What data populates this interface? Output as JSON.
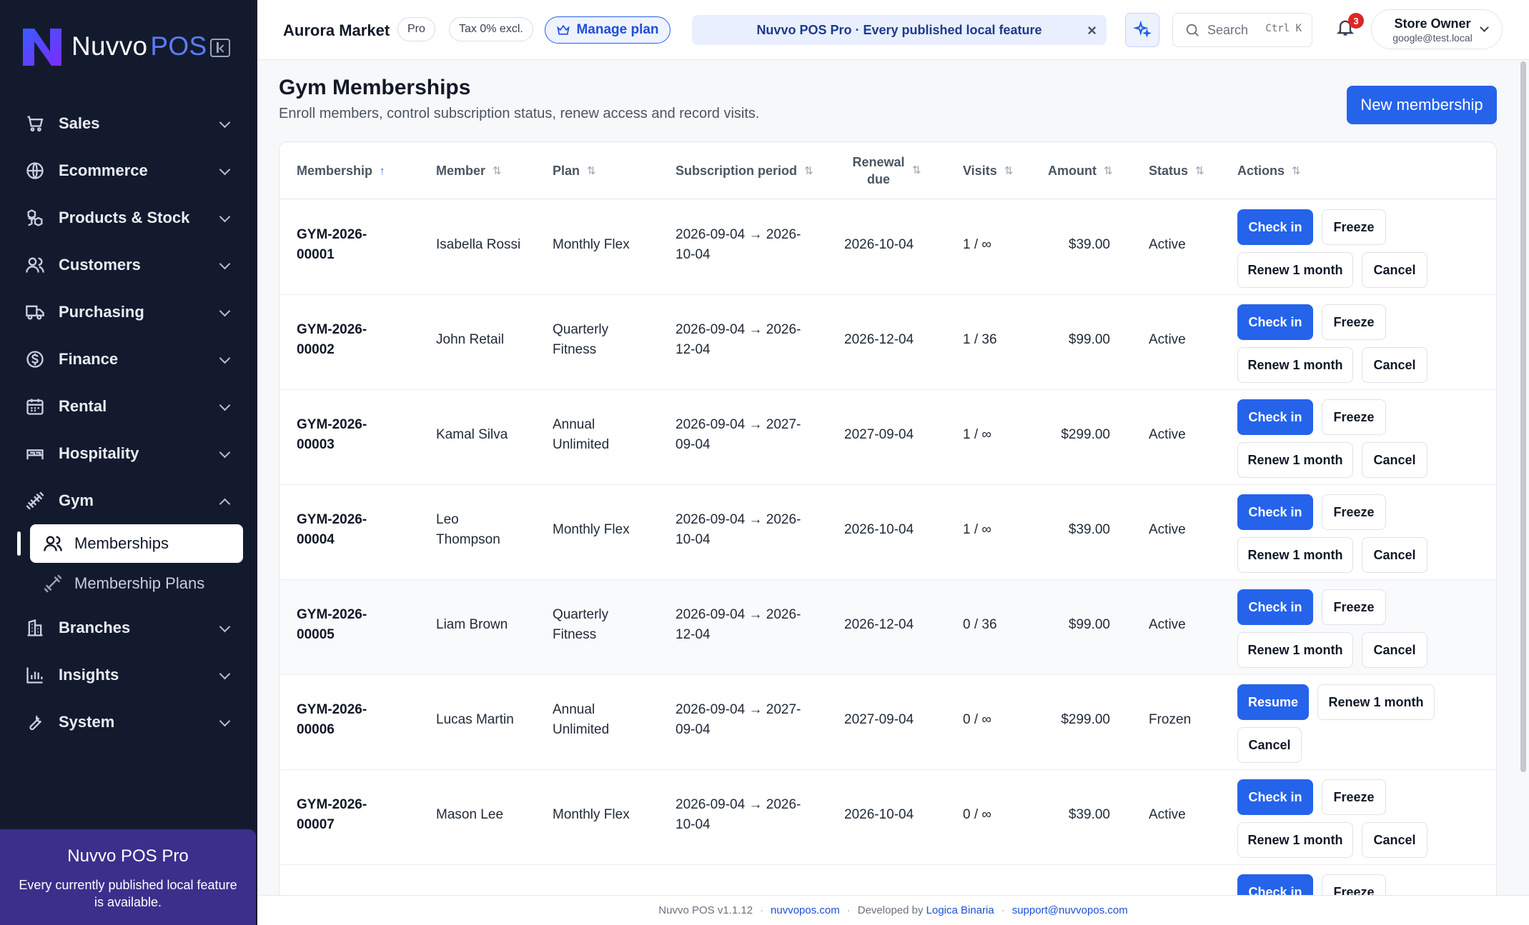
{
  "brand": {
    "name": "Nuvvo",
    "suffix": "POS"
  },
  "sidebar": {
    "items": [
      {
        "label": "Sales",
        "icon": "cart-icon"
      },
      {
        "label": "Ecommerce",
        "icon": "globe-icon"
      },
      {
        "label": "Products & Stock",
        "icon": "boxes-icon"
      },
      {
        "label": "Customers",
        "icon": "users-icon"
      },
      {
        "label": "Purchasing",
        "icon": "truck-icon"
      },
      {
        "label": "Finance",
        "icon": "dollar-icon"
      },
      {
        "label": "Rental",
        "icon": "calendar-icon"
      },
      {
        "label": "Hospitality",
        "icon": "bed-icon"
      },
      {
        "label": "Gym",
        "icon": "dumbbell-icon"
      },
      {
        "label": "Branches",
        "icon": "building-icon"
      },
      {
        "label": "Insights",
        "icon": "chart-icon"
      },
      {
        "label": "System",
        "icon": "wrench-icon"
      }
    ],
    "gym_sub": [
      {
        "label": "Memberships",
        "icon": "users-icon"
      },
      {
        "label": "Membership Plans",
        "icon": "dumbbell-icon"
      }
    ],
    "promo": {
      "title": "Nuvvo POS Pro",
      "text": "Every currently published local feature is available."
    }
  },
  "header": {
    "store": "Aurora Market",
    "plan_pill": "Pro",
    "tax_pill": "Tax 0% excl.",
    "manage_plan": "Manage plan",
    "banner": "Nuvvo POS Pro · Every published local feature",
    "banner_close": "×",
    "search_placeholder": "Search",
    "search_shortcut": "Ctrl K",
    "notifications": "3",
    "user_name": "Store Owner",
    "user_email": "google@test.local"
  },
  "page": {
    "title": "Gym Memberships",
    "subtitle": "Enroll members, control subscription status, renew access and record visits.",
    "new_button": "New membership"
  },
  "table": {
    "columns": {
      "membership": "Membership",
      "member": "Member",
      "plan": "Plan",
      "period": "Subscription period",
      "renewal_1": "Renewal",
      "renewal_2": "due",
      "visits": "Visits",
      "amount": "Amount",
      "status": "Status",
      "actions": "Actions"
    },
    "sort_asc": "↑",
    "sort_none": "⇅",
    "rows": [
      {
        "id1": "GYM-2026-",
        "id2": "00001",
        "member1": "Isabella Rossi",
        "member2": "",
        "plan1": "Monthly Flex",
        "plan2": "",
        "period1": "2026-09-04 → 2026-",
        "period2": "10-04",
        "renewal": "2026-10-04",
        "visits": "1 / ∞",
        "amount": "$39.00",
        "status": "Active",
        "actions": [
          "Check in",
          "Freeze",
          "Renew 1 month",
          "Cancel"
        ]
      },
      {
        "id1": "GYM-2026-",
        "id2": "00002",
        "member1": "John Retail",
        "member2": "",
        "plan1": "Quarterly",
        "plan2": "Fitness",
        "period1": "2026-09-04 → 2026-",
        "period2": "12-04",
        "renewal": "2026-12-04",
        "visits": "1 / 36",
        "amount": "$99.00",
        "status": "Active",
        "actions": [
          "Check in",
          "Freeze",
          "Renew 1 month",
          "Cancel"
        ]
      },
      {
        "id1": "GYM-2026-",
        "id2": "00003",
        "member1": "Kamal Silva",
        "member2": "",
        "plan1": "Annual",
        "plan2": "Unlimited",
        "period1": "2026-09-04 → 2027-",
        "period2": "09-04",
        "renewal": "2027-09-04",
        "visits": "1 / ∞",
        "amount": "$299.00",
        "status": "Active",
        "actions": [
          "Check in",
          "Freeze",
          "Renew 1 month",
          "Cancel"
        ]
      },
      {
        "id1": "GYM-2026-",
        "id2": "00004",
        "member1": "Leo",
        "member2": "Thompson",
        "plan1": "Monthly Flex",
        "plan2": "",
        "period1": "2026-09-04 → 2026-",
        "period2": "10-04",
        "renewal": "2026-10-04",
        "visits": "1 / ∞",
        "amount": "$39.00",
        "status": "Active",
        "actions": [
          "Check in",
          "Freeze",
          "Renew 1 month",
          "Cancel"
        ]
      },
      {
        "id1": "GYM-2026-",
        "id2": "00005",
        "member1": "Liam Brown",
        "member2": "",
        "plan1": "Quarterly",
        "plan2": "Fitness",
        "period1": "2026-09-04 → 2026-",
        "period2": "12-04",
        "renewal": "2026-12-04",
        "visits": "0 / 36",
        "amount": "$99.00",
        "status": "Active",
        "actions": [
          "Check in",
          "Freeze",
          "Renew 1 month",
          "Cancel"
        ]
      },
      {
        "id1": "GYM-2026-",
        "id2": "00006",
        "member1": "Lucas Martin",
        "member2": "",
        "plan1": "Annual",
        "plan2": "Unlimited",
        "period1": "2026-09-04 → 2027-",
        "period2": "09-04",
        "renewal": "2027-09-04",
        "visits": "0 / ∞",
        "amount": "$299.00",
        "status": "Frozen",
        "actions": [
          "Resume",
          "Renew 1 month",
          "Cancel"
        ]
      },
      {
        "id1": "GYM-2026-",
        "id2": "00007",
        "member1": "Mason Lee",
        "member2": "",
        "plan1": "Monthly Flex",
        "plan2": "",
        "period1": "2026-09-04 → 2026-",
        "period2": "10-04",
        "renewal": "2026-10-04",
        "visits": "0 / ∞",
        "amount": "$39.00",
        "status": "Active",
        "actions": [
          "Check in",
          "Freeze",
          "Renew 1 month",
          "Cancel"
        ]
      },
      {
        "id1": "",
        "id2": "",
        "member1": "",
        "member2": "",
        "plan1": "",
        "plan2": "",
        "period1": "",
        "period2": "",
        "renewal": "",
        "visits": "",
        "amount": "",
        "status": "",
        "actions": [
          "Check in",
          "Freeze"
        ]
      }
    ]
  },
  "footer": {
    "version": "Nuvvo POS v1.1.12",
    "site": "nuvvopos.com",
    "dev_prefix": "Developed by",
    "dev_name": "Logica Binaria",
    "support": "support@nuvvopos.com",
    "sep": "·"
  },
  "colors": {
    "sidebar_bg": "#141a2e",
    "accent": "#2563eb",
    "promo_bg": "#3b2f8c"
  }
}
